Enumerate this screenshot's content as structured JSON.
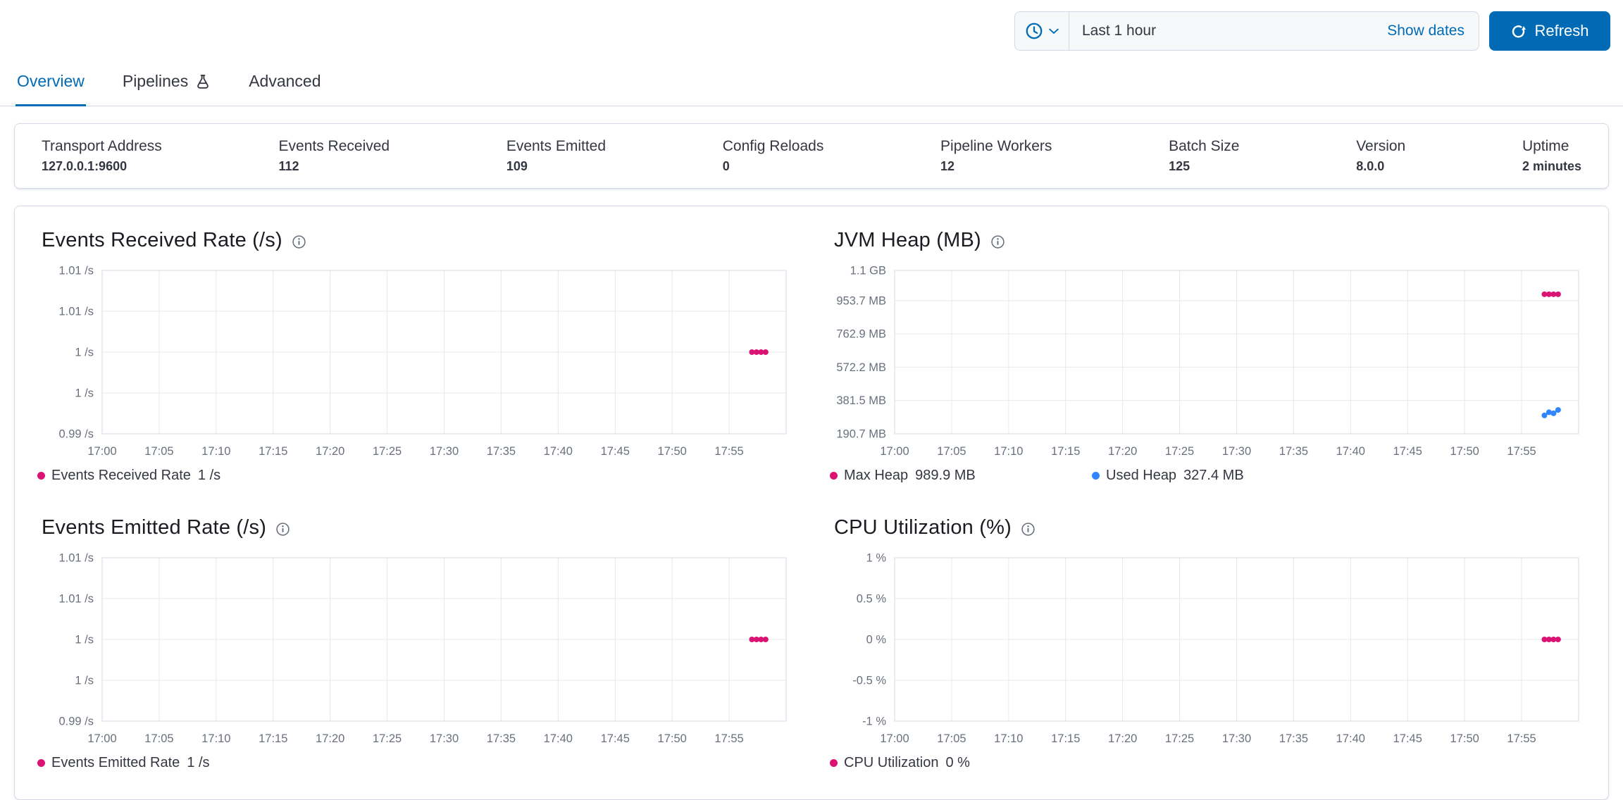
{
  "colors": {
    "primary": "#006BB4",
    "series_pink": "#DB1374",
    "series_blue": "#3185FC",
    "text": "#343741",
    "text_subdued": "#69707D",
    "border": "#D3DAE6",
    "grid": "#E4E8EE"
  },
  "header": {
    "time_picker": {
      "quick_select_icon": "clock-icon",
      "quick_select_arrow": "chevron-down-icon",
      "value": "Last 1 hour",
      "show_dates_label": "Show dates"
    },
    "refresh_button_icon": "refresh-icon",
    "refresh_button_label": "Refresh"
  },
  "tabs": [
    {
      "label": "Overview",
      "active": true
    },
    {
      "label": "Pipelines",
      "active": false,
      "icon": "beaker-icon"
    },
    {
      "label": "Advanced",
      "active": false
    }
  ],
  "summary_stats": [
    {
      "label": "Transport Address",
      "value": "127.0.0.1:9600"
    },
    {
      "label": "Events Received",
      "value": "112"
    },
    {
      "label": "Events Emitted",
      "value": "109"
    },
    {
      "label": "Config Reloads",
      "value": "0"
    },
    {
      "label": "Pipeline Workers",
      "value": "12"
    },
    {
      "label": "Batch Size",
      "value": "125"
    },
    {
      "label": "Version",
      "value": "8.0.0"
    },
    {
      "label": "Uptime",
      "value": "2 minutes"
    }
  ],
  "chart_data": [
    {
      "id": "events_received_rate",
      "type": "line",
      "title": "Events Received Rate (/s)",
      "x_domain_minutes": [
        0,
        60
      ],
      "x_ticks": [
        "17:00",
        "17:05",
        "17:10",
        "17:15",
        "17:20",
        "17:25",
        "17:30",
        "17:35",
        "17:40",
        "17:45",
        "17:50",
        "17:55"
      ],
      "y_domain": [
        0.99,
        1.01
      ],
      "y_ticks": [
        {
          "value": 1.01,
          "label": "1.01 /s"
        },
        {
          "value": 1.005,
          "label": "1.01 /s"
        },
        {
          "value": 1.0,
          "label": "1 /s"
        },
        {
          "value": 0.995,
          "label": "1 /s"
        },
        {
          "value": 0.99,
          "label": "0.99 /s"
        }
      ],
      "series": [
        {
          "name": "Events Received Rate",
          "legend_value": "1 /s",
          "color": "#DB1374",
          "points": [
            [
              57.0,
              1.0
            ],
            [
              57.4,
              1.0
            ],
            [
              57.8,
              1.0
            ],
            [
              58.2,
              1.0
            ]
          ]
        }
      ]
    },
    {
      "id": "jvm_heap",
      "type": "line",
      "title": "JVM Heap (MB)",
      "x_domain_minutes": [
        0,
        60
      ],
      "x_ticks": [
        "17:00",
        "17:05",
        "17:10",
        "17:15",
        "17:20",
        "17:25",
        "17:30",
        "17:35",
        "17:40",
        "17:45",
        "17:50",
        "17:55"
      ],
      "y_domain": [
        190.7,
        1126.4
      ],
      "y_ticks": [
        {
          "value": 1126.4,
          "label": "1.1 GB"
        },
        {
          "value": 953.7,
          "label": "953.7 MB"
        },
        {
          "value": 762.9,
          "label": "762.9 MB"
        },
        {
          "value": 572.2,
          "label": "572.2 MB"
        },
        {
          "value": 381.5,
          "label": "381.5 MB"
        },
        {
          "value": 190.7,
          "label": "190.7 MB"
        }
      ],
      "series": [
        {
          "name": "Max Heap",
          "legend_value": "989.9 MB",
          "color": "#DB1374",
          "points": [
            [
              57.0,
              989.9
            ],
            [
              57.4,
              989.9
            ],
            [
              57.8,
              989.9
            ],
            [
              58.2,
              989.9
            ]
          ]
        },
        {
          "name": "Used Heap",
          "legend_value": "327.4 MB",
          "color": "#3185FC",
          "points": [
            [
              57.0,
              296.0
            ],
            [
              57.4,
              314.0
            ],
            [
              57.8,
              308.0
            ],
            [
              58.2,
              327.4
            ]
          ]
        }
      ]
    },
    {
      "id": "events_emitted_rate",
      "type": "line",
      "title": "Events Emitted Rate (/s)",
      "x_domain_minutes": [
        0,
        60
      ],
      "x_ticks": [
        "17:00",
        "17:05",
        "17:10",
        "17:15",
        "17:20",
        "17:25",
        "17:30",
        "17:35",
        "17:40",
        "17:45",
        "17:50",
        "17:55"
      ],
      "y_domain": [
        0.99,
        1.01
      ],
      "y_ticks": [
        {
          "value": 1.01,
          "label": "1.01 /s"
        },
        {
          "value": 1.005,
          "label": "1.01 /s"
        },
        {
          "value": 1.0,
          "label": "1 /s"
        },
        {
          "value": 0.995,
          "label": "1 /s"
        },
        {
          "value": 0.99,
          "label": "0.99 /s"
        }
      ],
      "series": [
        {
          "name": "Events Emitted Rate",
          "legend_value": "1 /s",
          "color": "#DB1374",
          "points": [
            [
              57.0,
              1.0
            ],
            [
              57.4,
              1.0
            ],
            [
              57.8,
              1.0
            ],
            [
              58.2,
              1.0
            ]
          ]
        }
      ]
    },
    {
      "id": "cpu_utilization",
      "type": "line",
      "title": "CPU Utilization (%)",
      "x_domain_minutes": [
        0,
        60
      ],
      "x_ticks": [
        "17:00",
        "17:05",
        "17:10",
        "17:15",
        "17:20",
        "17:25",
        "17:30",
        "17:35",
        "17:40",
        "17:45",
        "17:50",
        "17:55"
      ],
      "y_domain": [
        -1,
        1
      ],
      "y_ticks": [
        {
          "value": 1,
          "label": "1 %"
        },
        {
          "value": 0.5,
          "label": "0.5 %"
        },
        {
          "value": 0,
          "label": "0 %"
        },
        {
          "value": -0.5,
          "label": "-0.5 %"
        },
        {
          "value": -1,
          "label": "-1 %"
        }
      ],
      "series": [
        {
          "name": "CPU Utilization",
          "legend_value": "0 %",
          "color": "#DB1374",
          "points": [
            [
              57.0,
              0
            ],
            [
              57.4,
              0
            ],
            [
              57.8,
              0
            ],
            [
              58.2,
              0
            ]
          ]
        }
      ]
    }
  ]
}
